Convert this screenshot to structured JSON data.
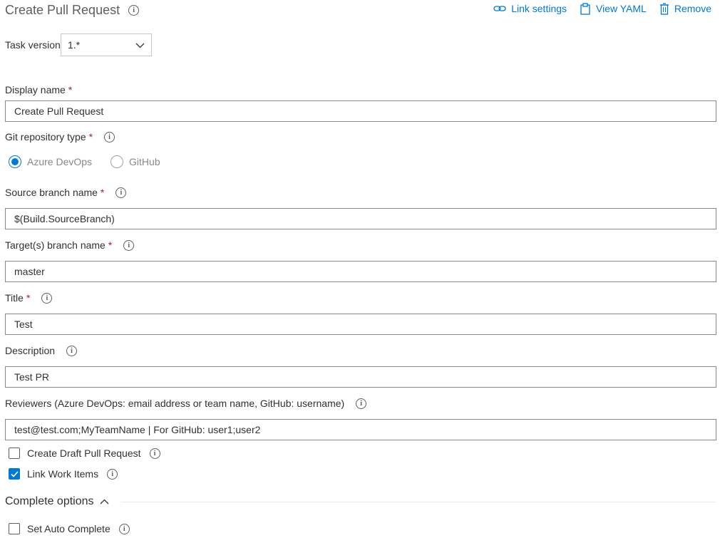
{
  "header": {
    "title": "Create Pull Request",
    "toolbar": {
      "link_settings": "Link settings",
      "view_yaml": "View YAML",
      "remove": "Remove"
    }
  },
  "task_version": {
    "label": "Task version",
    "value": "1.*"
  },
  "fields": {
    "display_name": {
      "label": "Display name",
      "required_mark": "*",
      "value": "Create Pull Request"
    },
    "git_repo_type": {
      "label": "Git repository type",
      "required_mark": "*",
      "options": [
        "Azure DevOps",
        "GitHub"
      ],
      "selected": "Azure DevOps"
    },
    "source_branch": {
      "label": "Source branch name",
      "required_mark": "*",
      "value": "$(Build.SourceBranch)"
    },
    "target_branch": {
      "label": "Target(s) branch name",
      "required_mark": "*",
      "value": "master"
    },
    "title": {
      "label": "Title",
      "required_mark": "*",
      "value": "Test"
    },
    "description": {
      "label": "Description",
      "value": "Test PR"
    },
    "reviewers": {
      "label": "Reviewers (Azure DevOps: email address or team name, GitHub: username)",
      "value": "test@test.com;MyTeamName | For GitHub: user1;user2"
    }
  },
  "checkboxes": {
    "draft": {
      "label": "Create Draft Pull Request",
      "checked": false
    },
    "link_work_items": {
      "label": "Link Work Items",
      "checked": true
    }
  },
  "complete_options": {
    "heading": "Complete options",
    "expanded": true,
    "auto_complete": {
      "label": "Set Auto Complete",
      "checked": false
    }
  },
  "colors": {
    "accent": "#0078d4",
    "required": "#a4262c",
    "text": "#323130"
  },
  "icons": [
    "info-icon",
    "link-icon",
    "clipboard-icon",
    "trash-icon",
    "chevron-down-icon",
    "chevron-up-icon",
    "checkmark-icon"
  ]
}
